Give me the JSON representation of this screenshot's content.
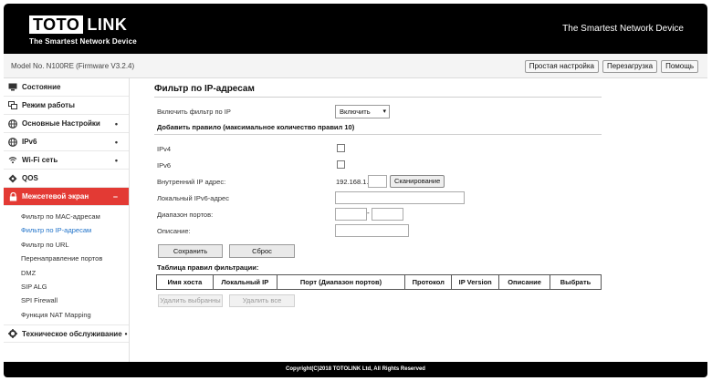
{
  "header": {
    "logo_left": "TOTO",
    "logo_right": "LINK",
    "logo_tagline": "The Smartest Network Device",
    "slogan": "The Smartest Network Device",
    "model": "Model No. N100RE (Firmware V3.2.4)",
    "buttons": [
      "Простая настройка",
      "Перезагрузка",
      "Помощь"
    ]
  },
  "sidebar": {
    "items": [
      {
        "label": "Состояние",
        "icon": "monitor-icon",
        "arrow": ""
      },
      {
        "label": "Режим работы",
        "icon": "mode-icon",
        "arrow": ""
      },
      {
        "label": "Основные Настройки",
        "icon": "globe-icon",
        "arrow": "•"
      },
      {
        "label": "IPv6",
        "icon": "globe-icon",
        "arrow": "•"
      },
      {
        "label": "Wi-Fi сеть",
        "icon": "wifi-icon",
        "arrow": "•"
      },
      {
        "label": "QOS",
        "icon": "qos-icon",
        "arrow": ""
      },
      {
        "label": "Межсетевой экран",
        "icon": "lock-icon",
        "arrow": "−"
      }
    ],
    "subitems": [
      "Фильтр по MAC-адресам",
      "Фильтр по IP-адресам",
      "Фильтр по URL",
      "Перенаправление портов",
      "DMZ",
      "SIP ALG",
      "SPI Firewall",
      "Функция NAT Mapping"
    ],
    "active_subitem": 1,
    "maintenance": {
      "label": "Техническое обслуживание",
      "arrow": "•"
    }
  },
  "main": {
    "title": "Фильтр по IP-адресам",
    "enable_label": "Включить фильтр по IP",
    "enable_value": "Включить",
    "add_rule_heading": "Добавить правило (максимальное количество правил 10)",
    "ipv4_label": "IPv4",
    "ipv6_label": "IPv6",
    "local_ip_label": "Внутренний IP адрес:",
    "ip_prefix": "192.168.1.",
    "scan_button": "Сканирование",
    "local_ipv6_label": "Локальный IPv6-адрес",
    "port_range_label": "Диапазон портов:",
    "port_dash": "-",
    "description_label": "Описание:",
    "save_button": "Сохранить",
    "reset_button": "Сброс",
    "table_title": "Таблица правил фильтрации:",
    "table_headers": [
      "Имя хоста",
      "Локальный IP",
      "Порт (Диапазон портов)",
      "Протокол",
      "IP Version",
      "Описание",
      "Выбрать"
    ],
    "delete_selected": "Удалить выбранны",
    "delete_all": "Удалить все"
  },
  "footer": {
    "copyright": "Copyright(C)2018 TOTOLINK Ltd, All Rights Reserved"
  },
  "colors": {
    "accent": "#e33a34",
    "active_link": "#1f72c9",
    "header_bg": "#000000"
  }
}
